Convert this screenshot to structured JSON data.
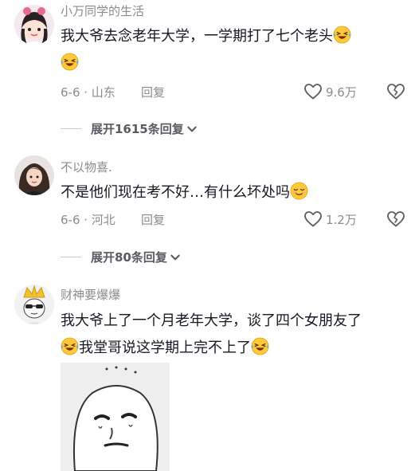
{
  "comments": [
    {
      "username": "小万同学的生活",
      "text_line1": "我大爷去念老年大学，一学期打了七个老头",
      "meta": "6-6 · 山东",
      "reply_label": "回复",
      "likes": "9.6万",
      "expand_label": "展开1615条回复"
    },
    {
      "username": "不以物喜.",
      "text_line1": "不是他们现在考不好…有什么坏处吗",
      "meta": "6-6 · 河北",
      "reply_label": "回复",
      "likes": "1.2万",
      "expand_label": "展开80条回复"
    },
    {
      "username": "财神要爆爆",
      "text_line1": "我大爷上了一个月老年大学，谈了四个女朋友了",
      "text_line2": "我堂哥说这学期上完不上了"
    }
  ],
  "icons": {
    "laugh_cry": "laugh-cry-emoji",
    "relieved": "relieved-emoji",
    "like": "heart-outline",
    "dislike": "broken-heart",
    "chevron": "chevron-down"
  },
  "colors": {
    "text": "#161823",
    "muted": "#8a8b91",
    "expand": "#5a5b62",
    "emoji_yellow": "#ffc83d"
  }
}
